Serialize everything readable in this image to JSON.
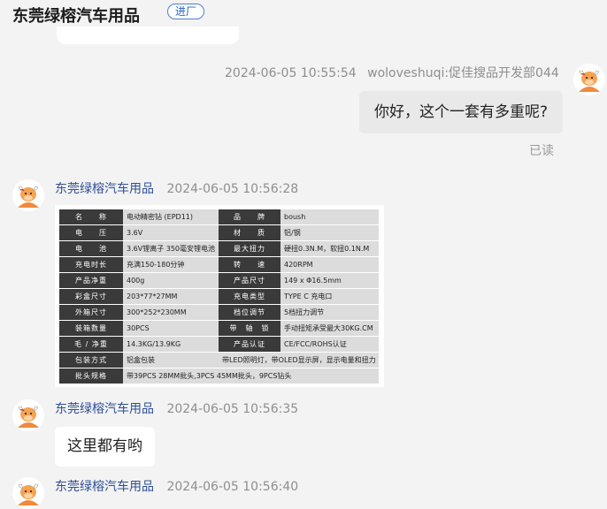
{
  "header": {
    "shop_name": "东莞绿榕汽车用品",
    "enter_label": "进厂"
  },
  "messages": [
    {
      "side": "right",
      "time": "2024-06-05 10:55:54",
      "sender": "woloveshuqi:促佳搜品开发部044",
      "text": "你好，这个一套有多重呢?",
      "status": "已读"
    },
    {
      "side": "left",
      "sender": "东莞绿榕汽车用品",
      "time": "2024-06-05 10:56:28",
      "type": "spec-image",
      "specs": [
        [
          "名　　称",
          "电动精密钻 (EPD11)",
          "品　　牌",
          "boush"
        ],
        [
          "电　　压",
          "3.6V",
          "材　　质",
          "铝/钢"
        ],
        [
          "电　　池",
          "3.6V锂离子 350毫安锂电池",
          "最大扭力",
          "硬扭0.3N.M，软扭0.1N.M"
        ],
        [
          "充电时长",
          "充满150-180分钟",
          "转　　速",
          "420RPM"
        ],
        [
          "产品净重",
          "400g",
          "产品尺寸",
          "149 x Φ16.5mm"
        ],
        [
          "彩盒尺寸",
          "203*77*27MM",
          "充电类型",
          "TYPE C 充电口"
        ],
        [
          "外箱尺寸",
          "300*252*230MM",
          "档位调节",
          "5档扭力调节"
        ],
        [
          "装箱数量",
          "30PCS",
          "带　轴　锁",
          "手动扭矩承受最大30KG.CM"
        ],
        [
          "毛 / 净重",
          "14.3KG/13.9KG",
          "产品认证",
          "CE/FCC/ROHS认证"
        ],
        [
          "包装方式",
          "铝盒包装",
          "",
          "带LED照明灯，带OLED显示屏，显示电量和扭力"
        ],
        [
          "批头规格",
          "带39PCS 28MM批头,3PCS 45MM批头，9PCS钻头",
          "",
          ""
        ]
      ]
    },
    {
      "side": "left",
      "sender": "东莞绿榕汽车用品",
      "time": "2024-06-05 10:56:35",
      "text": "这里都有哟"
    },
    {
      "side": "left",
      "sender": "东莞绿榕汽车用品",
      "time": "2024-06-05 10:56:40"
    }
  ]
}
